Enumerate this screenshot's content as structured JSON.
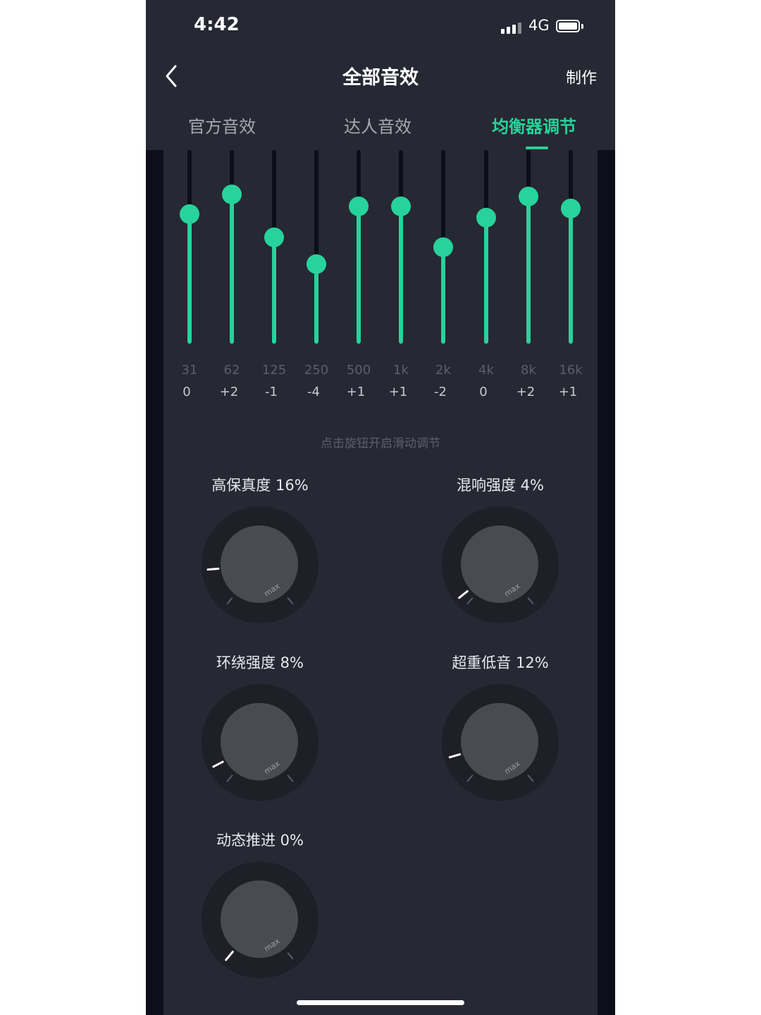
{
  "status_bar": {
    "time": "4:42",
    "network": "4G"
  },
  "header": {
    "title": "全部音效",
    "action": "制作"
  },
  "tabs": [
    {
      "label": "官方音效",
      "active": false
    },
    {
      "label": "达人音效",
      "active": false
    },
    {
      "label": "均衡器调节",
      "active": true
    }
  ],
  "equalizer": {
    "bands": [
      {
        "freq": "31",
        "value": "0",
        "level": 0.67
      },
      {
        "freq": "62",
        "value": "+2",
        "level": 0.77
      },
      {
        "freq": "125",
        "value": "-1",
        "level": 0.55
      },
      {
        "freq": "250",
        "value": "-4",
        "level": 0.41
      },
      {
        "freq": "500",
        "value": "+1",
        "level": 0.71
      },
      {
        "freq": "1k",
        "value": "+1",
        "level": 0.71
      },
      {
        "freq": "2k",
        "value": "-2",
        "level": 0.5
      },
      {
        "freq": "4k",
        "value": "0",
        "level": 0.65
      },
      {
        "freq": "8k",
        "value": "+2",
        "level": 0.76
      },
      {
        "freq": "16k",
        "value": "+1",
        "level": 0.7
      }
    ]
  },
  "hint": "点击旋钮开启滑动调节",
  "knobs": [
    {
      "label": "高保真度 16%",
      "percent": 16,
      "max_label": "max"
    },
    {
      "label": "混响强度 4%",
      "percent": 4,
      "max_label": "max"
    },
    {
      "label": "环绕强度 8%",
      "percent": 8,
      "max_label": "max"
    },
    {
      "label": "超重低音 12%",
      "percent": 12,
      "max_label": "max"
    },
    {
      "label": "动态推进 0%",
      "percent": 0,
      "max_label": "max"
    }
  ],
  "colors": {
    "accent": "#27d39a",
    "background": "#262833",
    "sidebar": "#0d0e1a"
  }
}
